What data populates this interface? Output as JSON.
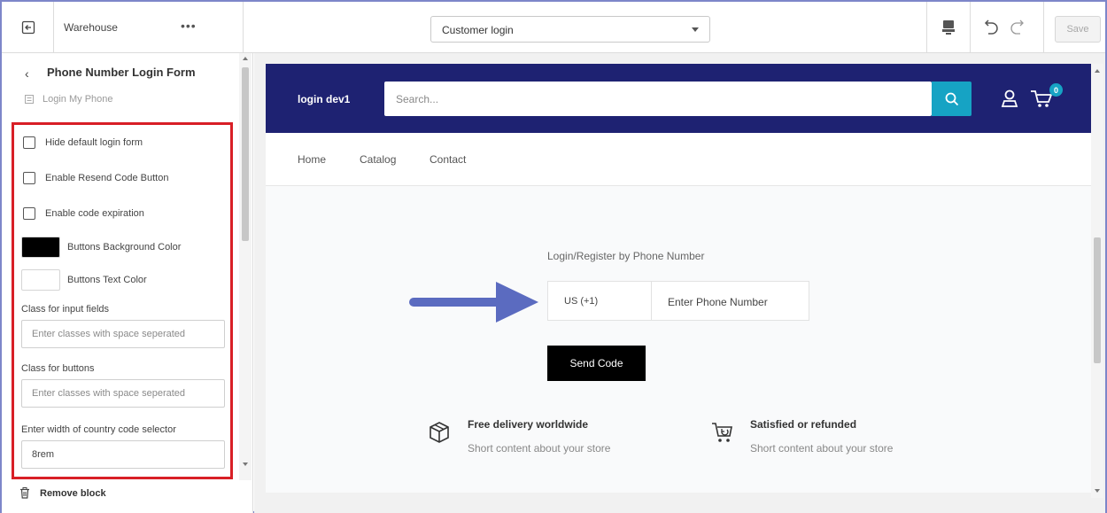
{
  "topbar": {
    "store_name": "Warehouse",
    "more_icon": "ellipsis-icon",
    "page_select_value": "Customer login",
    "save_label": "Save"
  },
  "sidebar": {
    "back_icon": "chevron-left-icon",
    "title": "Phone Number Login Form",
    "subtitle": "Login My Phone",
    "checkboxes": [
      {
        "label": "Hide default login form",
        "checked": false
      },
      {
        "label": "Enable Resend Code Button",
        "checked": false
      },
      {
        "label": "Enable code expiration",
        "checked": false
      }
    ],
    "colors": [
      {
        "label": "Buttons Background Color",
        "value": "#000000"
      },
      {
        "label": "Buttons Text Color",
        "value": "#ffffff"
      }
    ],
    "fields": [
      {
        "label": "Class for input fields",
        "placeholder": "Enter classes with space seperated",
        "value": ""
      },
      {
        "label": "Class for buttons",
        "placeholder": "Enter classes with space seperated",
        "value": ""
      },
      {
        "label": "Enter width of country code selector",
        "placeholder": "",
        "value": "8rem"
      }
    ],
    "remove_label": "Remove block",
    "highlight_color": "#d81f26"
  },
  "preview": {
    "logo": "login dev1",
    "search_placeholder": "Search...",
    "cart_count": "0",
    "header_color": "#1e2272",
    "accent_color": "#16a3c4",
    "nav": [
      "Home",
      "Catalog",
      "Contact"
    ],
    "login_title": "Login/Register by Phone Number",
    "country_code": "US (+1)",
    "phone_placeholder": "Enter Phone Number",
    "send_label": "Send Code",
    "arrow_color": "#5b6bc0",
    "features": [
      {
        "icon": "package-icon",
        "title": "Free delivery worldwide",
        "text": "Short content about your store"
      },
      {
        "icon": "cart-return-icon",
        "title": "Satisfied or refunded",
        "text": "Short content about your store"
      }
    ]
  }
}
